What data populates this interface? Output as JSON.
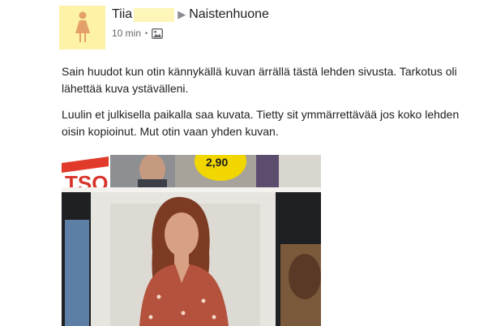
{
  "post": {
    "author_first_name": "Tiia",
    "group_name": "Naistenhuone",
    "time_ago": "10 min",
    "separator": "•",
    "audience_icon": "photo-audience-icon",
    "avatar_icon": "female-silhouette-icon",
    "paragraphs": [
      "Sain huudot kun otin kännykällä kuvan ärrällä tästä lehden sivusta. Tarkotus oli lähettää kuva ystävälleni.",
      "Luulin et julkisella paikalla saa kuvata. Tietty sit ymmärrettävää jos koko lehden oisin kopioinut. Mut otin vaan yhden kuvan."
    ],
    "photo_visible_text": [
      "TSO",
      "2,90"
    ]
  },
  "colors": {
    "avatar_bg": "#fdf2a6",
    "avatar_figure": "#e3a069",
    "redaction": "#fdf6b8",
    "text": "#1c1e21",
    "meta_text": "#65676b",
    "price_sticker": "#f2d600"
  }
}
